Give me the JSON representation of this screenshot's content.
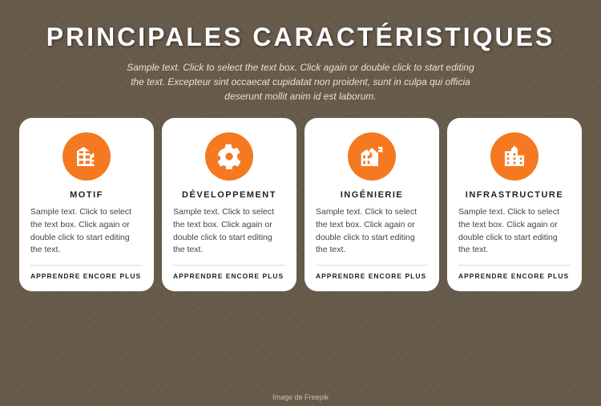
{
  "page": {
    "title": "PRINCIPALES CARACTÉRISTIQUES",
    "subtitle": "Sample text. Click to select the text box. Click again or double click to start editing the text. Excepteur sint occaecat cupidatat non proident, sunt in culpa qui officia deserunt mollit anim id est laborum.",
    "image_credit": "Image de Freepik"
  },
  "cards": [
    {
      "id": "motif",
      "title": "MOTIF",
      "icon": "building",
      "body": "Sample text. Click to select the text box. Click again or double click to start editing the text.",
      "link": "APPRENDRE ENCORE PLUS"
    },
    {
      "id": "developpement",
      "title": "DÉVELOPPEMENT",
      "icon": "gear",
      "body": "Sample text. Click to select the text box. Click again or double click to start editing the text.",
      "link": "APPRENDRE ENCORE PLUS"
    },
    {
      "id": "ingenierie",
      "title": "INGÉNIERIE",
      "icon": "chart-building",
      "body": "Sample text. Click to select the text box. Click again or double click to start editing the text.",
      "link": "APPRENDRE ENCORE PLUS"
    },
    {
      "id": "infrastructure",
      "title": "INFRASTRUCTURE",
      "icon": "city",
      "body": "Sample text. Click to select the text box. Click again or double click to start editing the text.",
      "link": "APPRENDRE ENCORE PLUS"
    }
  ]
}
